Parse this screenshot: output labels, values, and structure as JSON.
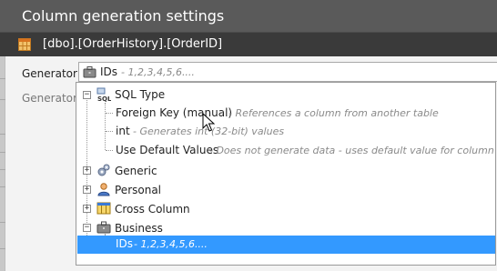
{
  "window": {
    "title": "Column generation settings",
    "column_path": "[dbo].[OrderHistory].[OrderID]"
  },
  "generator": {
    "label": "Generator:",
    "description_label": "Generator s",
    "selected_value": "IDs",
    "selected_hint": "- 1,2,3,4,5,6...."
  },
  "tree": {
    "sql_type": {
      "label": "SQL Type",
      "icon": "sql-icon",
      "children": [
        {
          "label": "Foreign Key (manual)",
          "desc": "- References a column from another table"
        },
        {
          "label": "int",
          "desc": "- Generates int (32-bit) values"
        },
        {
          "label": "Use Default Values",
          "desc": "- Does not generate data - uses default value for column"
        }
      ]
    },
    "categories": [
      {
        "label": "Generic",
        "icon": "gears-icon"
      },
      {
        "label": "Personal",
        "icon": "person-icon"
      },
      {
        "label": "Cross Column",
        "icon": "columns-icon"
      },
      {
        "label": "Business",
        "icon": "briefcase-icon"
      }
    ],
    "selected_item": {
      "label": "IDs",
      "desc": "- 1,2,3,4,5,6...."
    }
  },
  "colors": {
    "titlebar_bg": "#5a5a5a",
    "subbar_bg": "#3a3a3a",
    "selection": "#3399ff"
  }
}
